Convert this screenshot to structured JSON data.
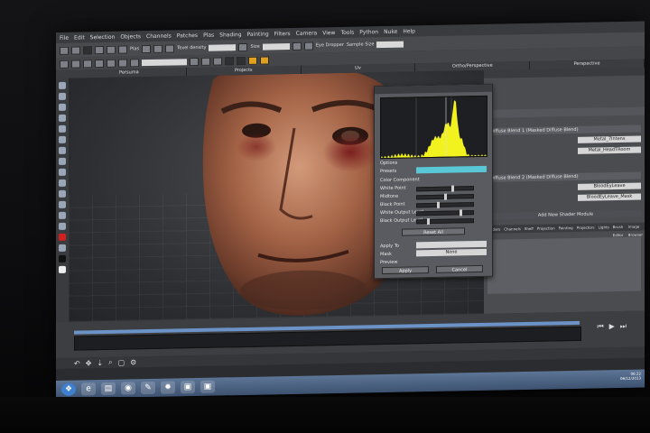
{
  "menu": [
    "File",
    "Edit",
    "Selection",
    "Objects",
    "Channels",
    "Patches",
    "Plas",
    "Shading",
    "Painting",
    "Filters",
    "Camera",
    "View",
    "Tools",
    "Python",
    "Nuke",
    "Help"
  ],
  "toolbar": {
    "plas_label": "Plas",
    "texel_density_label": "Texel density",
    "size_label": "Size",
    "eye_dropper_label": "Eye Dropper",
    "sample_size_label": "Sample Size"
  },
  "view_tabs": [
    "Persuma",
    "Projects",
    "Uv",
    "Ortho/Perspective",
    "Perspective"
  ],
  "right_panel": {
    "layer1_title": "Diffuse Blend 1 (Masked Diffuse Blend)",
    "layer1_field1": "Metal_7Intens",
    "layer1_field2": "Metal_HeadTRoom",
    "layer2_title": "Diffuse Blend 2 (Masked Diffuse Blend)",
    "layer2_field1": "BloodEyLeave",
    "layer2_field2": "BloodEyLeave_Mask",
    "add_shader_label": "Add New Shader Module",
    "tabs": [
      "Shaders",
      "Channels",
      "Shelf",
      "Projection",
      "Painting",
      "Projectors",
      "Lights",
      "Brush Editor",
      "Image Browser"
    ]
  },
  "histogram_dialog": {
    "options_label": "Options",
    "presets_label": "Presets",
    "color_component_label": "Color Component",
    "white_point_label": "White Point",
    "midtone_label": "Midtone",
    "black_point_label": "Black Point",
    "white_output_label": "White Output Level",
    "black_output_label": "Black Output Level",
    "reset_all_label": "Reset All",
    "apply_to_label": "Apply To",
    "mask_label": "Mask",
    "mask_value": "None",
    "preview_label": "Preview",
    "apply_button": "Apply",
    "cancel_button": "Cancel",
    "sliders": {
      "white_point": 0.62,
      "midtone": 0.48,
      "black_point": 0.35,
      "white_output": 0.76,
      "black_output": 0.18
    }
  },
  "taskbar": {
    "apps": [
      "start",
      "ie",
      "explorer",
      "chrome",
      "pin",
      "mari",
      "task1",
      "task2"
    ],
    "time": "06:22",
    "date": "06/12/2013"
  },
  "colors": {
    "histogram": "#f2f21f",
    "accent": "#59c7d6",
    "timeline": "#6b93c7"
  }
}
